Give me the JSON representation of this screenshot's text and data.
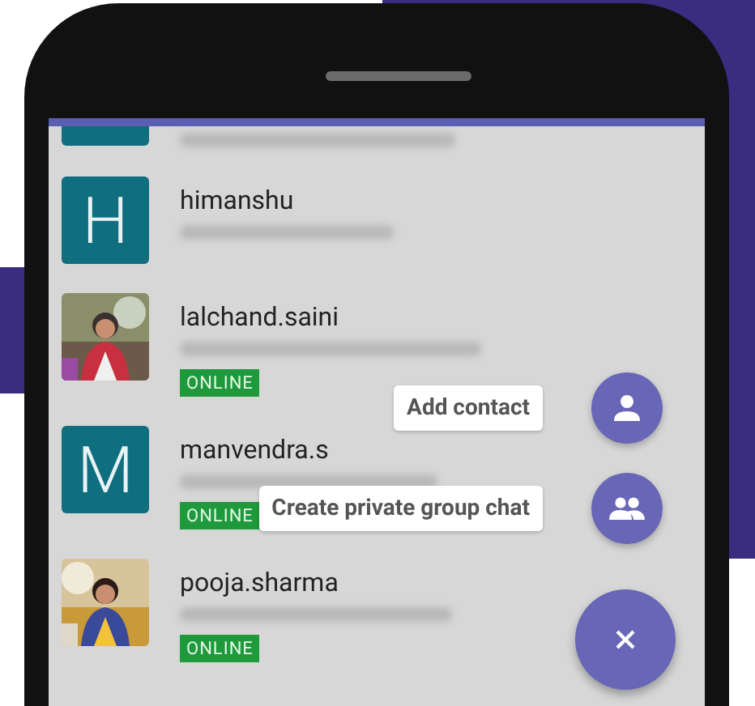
{
  "contacts": [
    {
      "kind": "letter",
      "online": false
    },
    {
      "kind": "letter",
      "avatar": "H",
      "name": "himanshu",
      "online": false
    },
    {
      "name": "lalchand.saini",
      "online": true,
      "badge": "ONLINE"
    },
    {
      "kind": "letter",
      "avatar": "M",
      "name": "manvendra.s",
      "online": true,
      "badge": "ONLINE"
    },
    {
      "name": "pooja.sharma",
      "online": true,
      "badge": "ONLINE"
    }
  ],
  "fab_actions": [
    {
      "kind": "person",
      "label": "Add contact"
    },
    {
      "kind": "group",
      "label": "Create private group chat"
    }
  ],
  "fab": {
    "expanded": true
  }
}
